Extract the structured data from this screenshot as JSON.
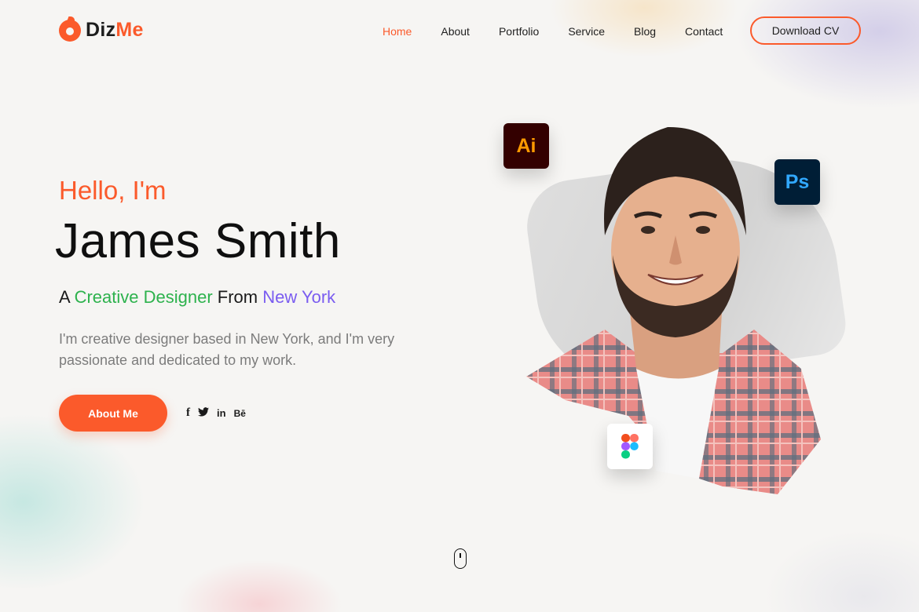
{
  "brand": {
    "name_part1": "Diz",
    "name_part2": "Me"
  },
  "nav": {
    "items": [
      {
        "label": "Home",
        "active": true
      },
      {
        "label": "About",
        "active": false
      },
      {
        "label": "Portfolio",
        "active": false
      },
      {
        "label": "Service",
        "active": false
      },
      {
        "label": "Blog",
        "active": false
      },
      {
        "label": "Contact",
        "active": false
      }
    ],
    "cta_label": "Download CV"
  },
  "hero": {
    "greeting": "Hello, I'm",
    "name": "James Smith",
    "tagline": {
      "prefix": "A ",
      "role": "Creative Designer",
      "middle": " From ",
      "location": "New York"
    },
    "description": "I'm creative designer based in New York, and I'm very passionate and dedicated to my work.",
    "button_label": "About Me",
    "social_icons": [
      {
        "icon": "facebook-icon",
        "glyph": "f"
      },
      {
        "icon": "twitter-icon",
        "glyph": "🐦"
      },
      {
        "icon": "linkedin-icon",
        "glyph": "in"
      },
      {
        "icon": "behance-icon",
        "glyph": "Bē"
      }
    ]
  },
  "tool_badges": [
    {
      "icon": "adobe-illustrator-icon",
      "text": "Ai"
    },
    {
      "icon": "adobe-photoshop-icon",
      "text": "Ps"
    },
    {
      "icon": "figma-icon"
    }
  ],
  "colors": {
    "accent": "#fb5a2b",
    "green": "#2db24d",
    "purple": "#7a5cf0"
  }
}
